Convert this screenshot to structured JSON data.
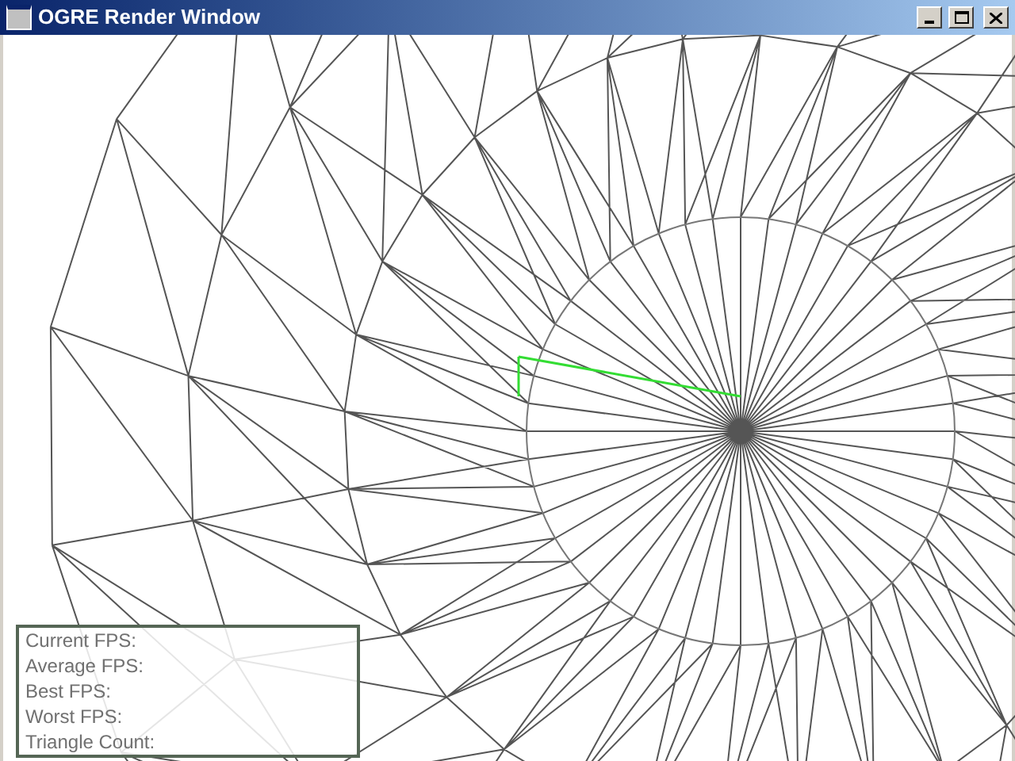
{
  "window": {
    "title": "OGRE Render Window"
  },
  "stats": [
    "Current FPS:",
    "Average FPS:",
    "Best FPS:",
    "Worst FPS:",
    "Triangle Count:"
  ]
}
